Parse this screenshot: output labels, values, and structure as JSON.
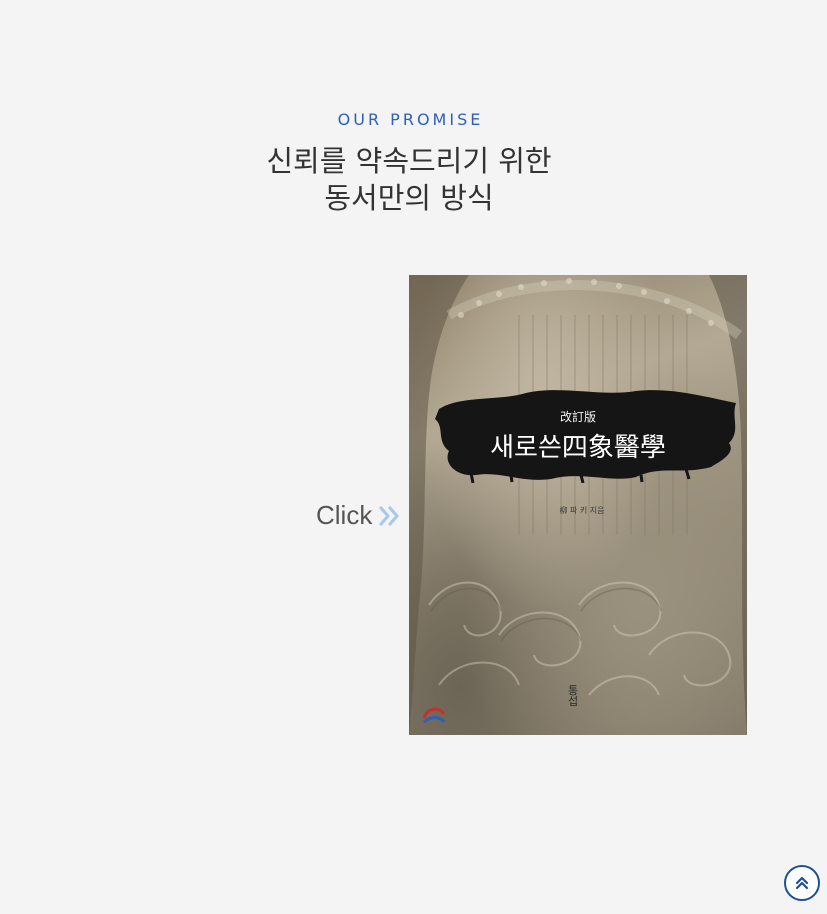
{
  "section": {
    "eyebrow": "OUR PROMISE",
    "headline_line1": "신뢰를 약속드리기 위한",
    "headline_line2": "동서만의 방식"
  },
  "link": {
    "label": "Click",
    "icon": "double-chevron-right-icon",
    "icon_color": "#a9c8ee"
  },
  "book": {
    "edition": "改訂版",
    "title": "새로쓴四象醫學",
    "author": "柳 파 키 지음",
    "publisher": "통섭",
    "ink_color": "#151515"
  },
  "scroll_top": {
    "icon": "double-chevron-up-icon",
    "color": "#1c4f99"
  },
  "colors": {
    "background": "#f4f4f4",
    "eyebrow": "#2f5fb8",
    "headline": "#333333"
  }
}
